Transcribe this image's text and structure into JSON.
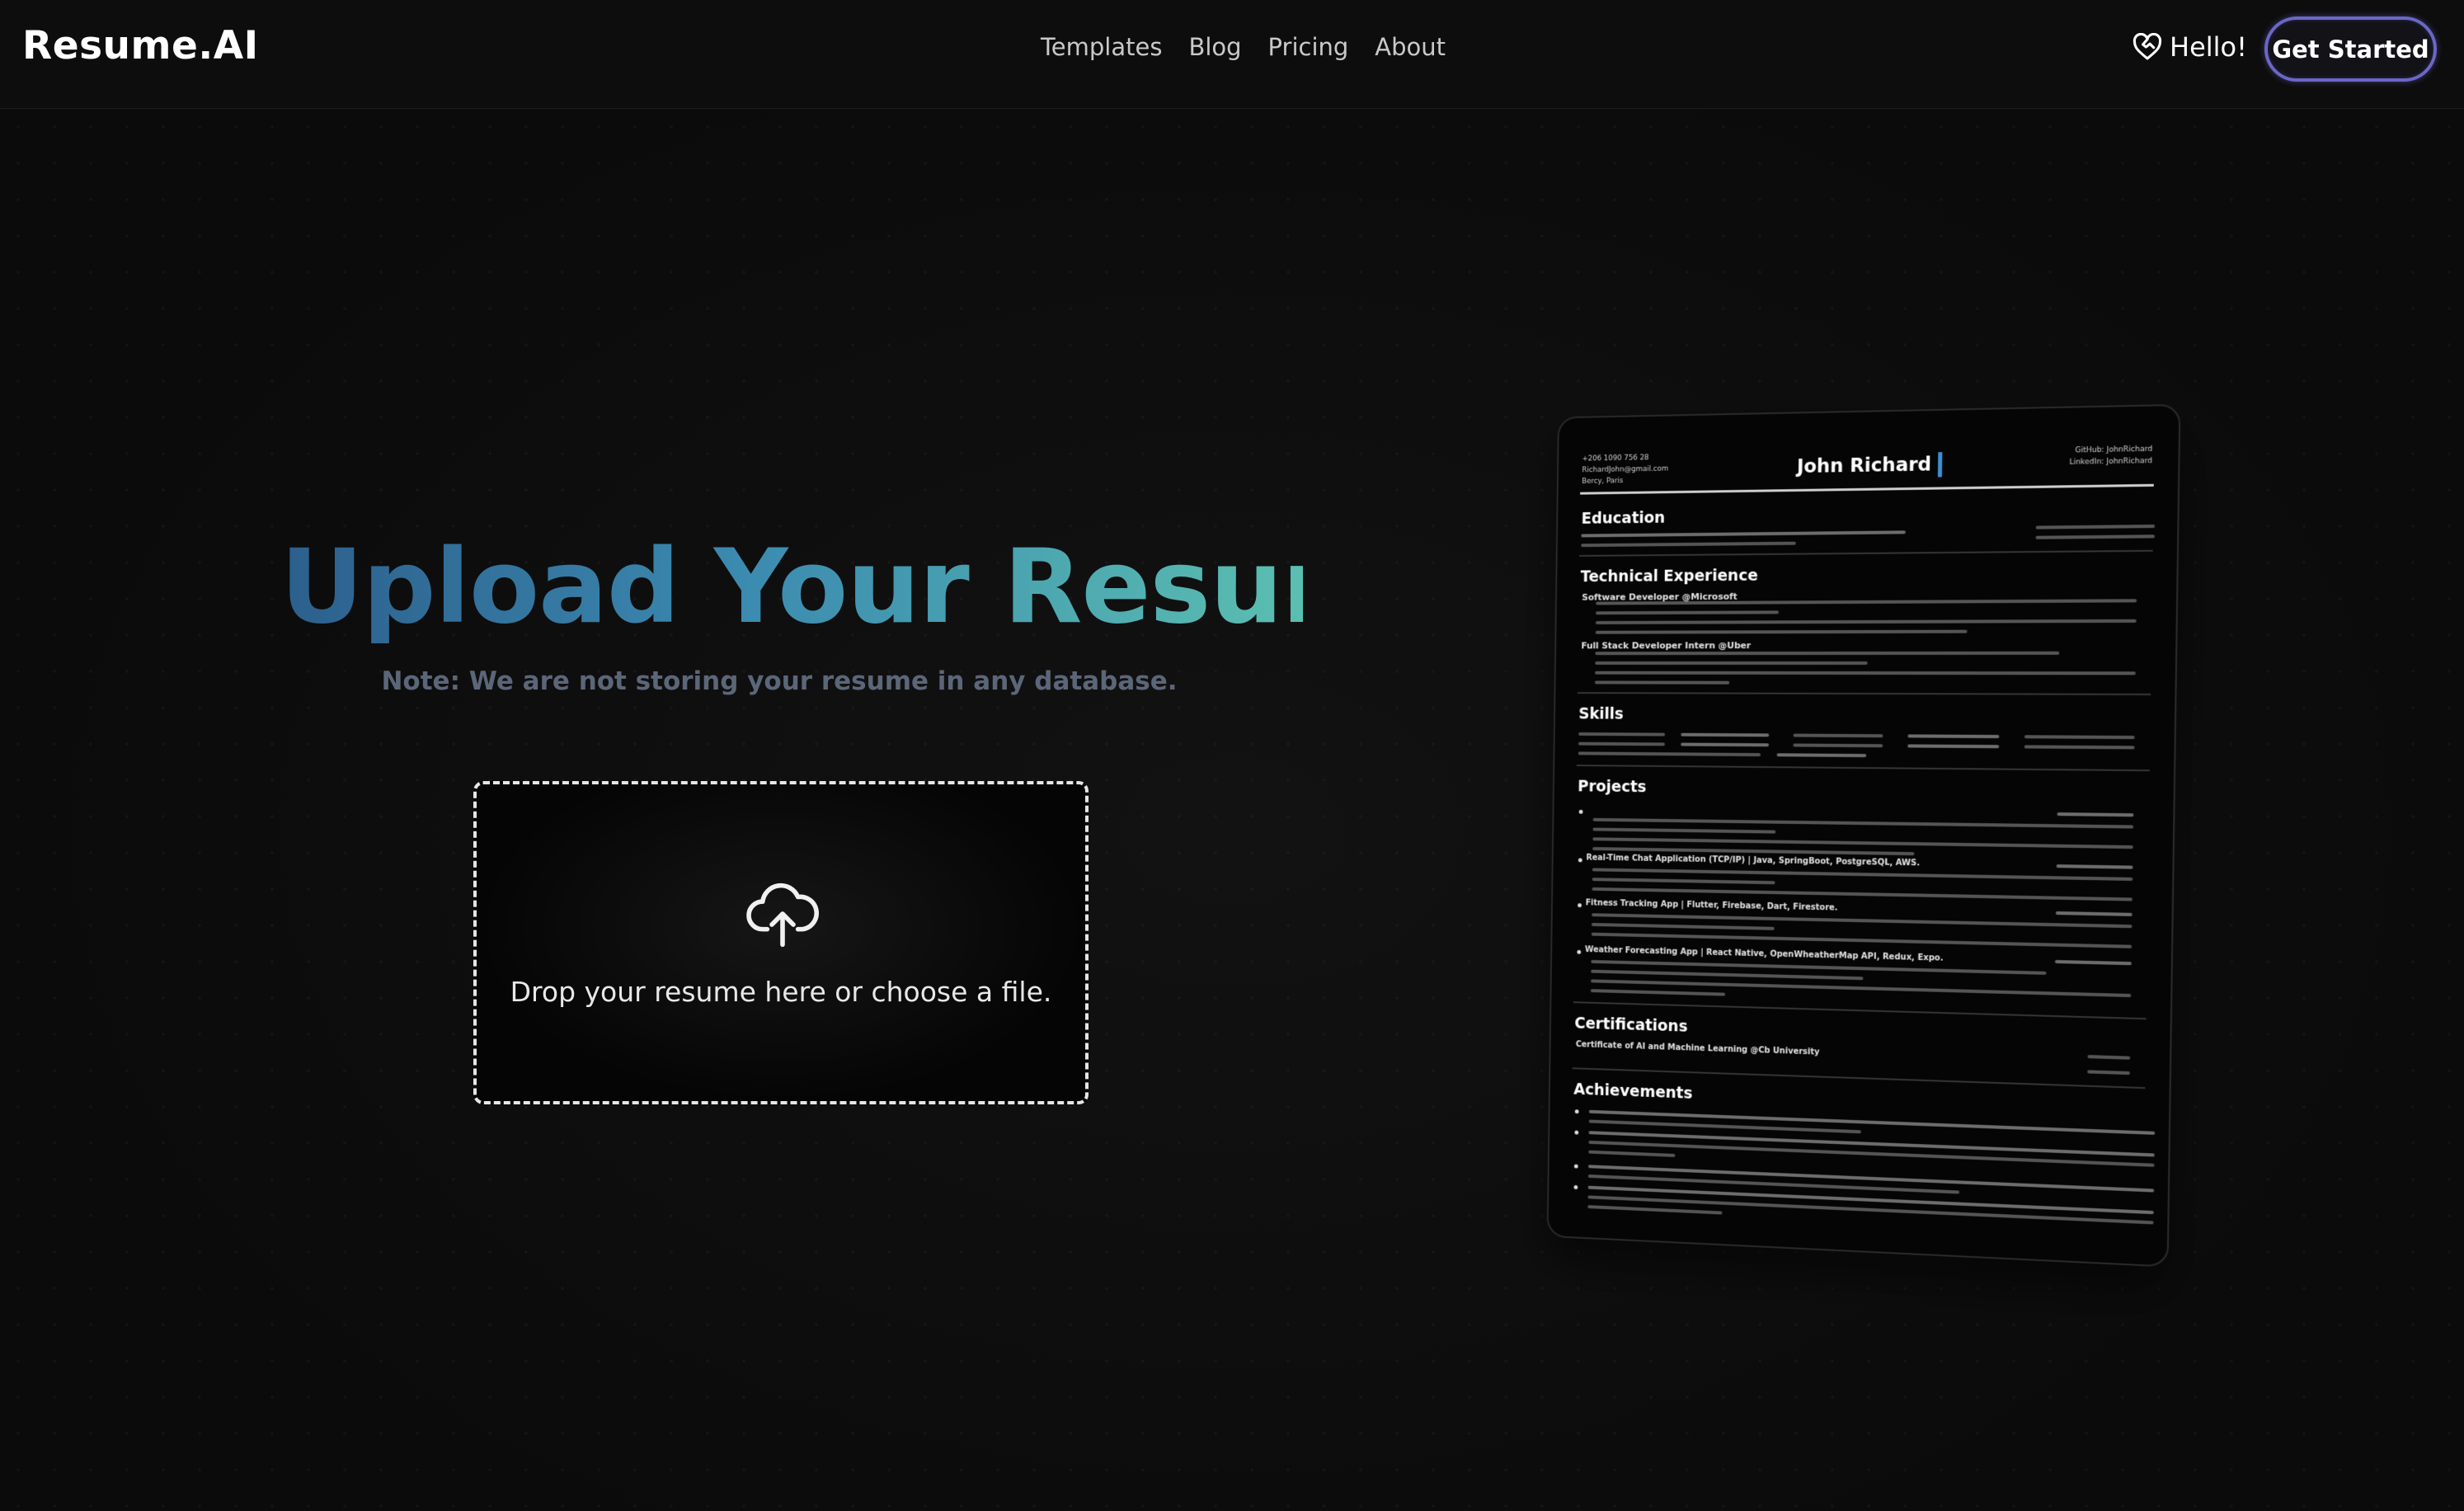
{
  "header": {
    "logo": "Resume.AI",
    "nav": [
      "Templates",
      "Blog",
      "Pricing",
      "About"
    ],
    "hello_label": "Hello!",
    "cta_label": "Get Started"
  },
  "hero": {
    "title": "Upload Your Resume",
    "note": "Note: We are not storing your resume in any database."
  },
  "upload": {
    "prompt": "Drop your resume here or choose a file.",
    "icon": "cloud-upload-icon"
  },
  "resume_preview": {
    "name": "John Richard",
    "contact_left": [
      "+206 1090 756 28",
      "RichardJohn@gmail.com",
      "Bercy, Paris"
    ],
    "contact_right": [
      "GitHub: JohnRichard",
      "LinkedIn: JohnRichard"
    ],
    "sections": {
      "education": "Education",
      "experience": "Technical Experience",
      "skills": "Skills",
      "projects": "Projects",
      "certifications": "Certifications",
      "achievements": "Achievements"
    },
    "experience_items": [
      "Software Developer @Microsoft",
      "Full Stack Developer Intern @Uber"
    ],
    "project_items": [
      "Real-Time Chat Application (TCP/IP) | Java, SpringBoot, PostgreSQL, AWS.",
      "Fitness Tracking App | Flutter, Firebase, Dart, Firestore.",
      "Weather Forecasting App | React Native, OpenWheatherMap API, Redux, Expo."
    ],
    "certification_item": "Certificate of AI and Machine Learning @Cb University"
  },
  "colors": {
    "background": "#0c0c0c",
    "title_gradient_start": "#2c5f8c",
    "title_gradient_end": "#5bbfb0",
    "cta_border": "#6a67c6",
    "note_text": "#5c6679",
    "name_cursor": "#3b8fd6"
  }
}
